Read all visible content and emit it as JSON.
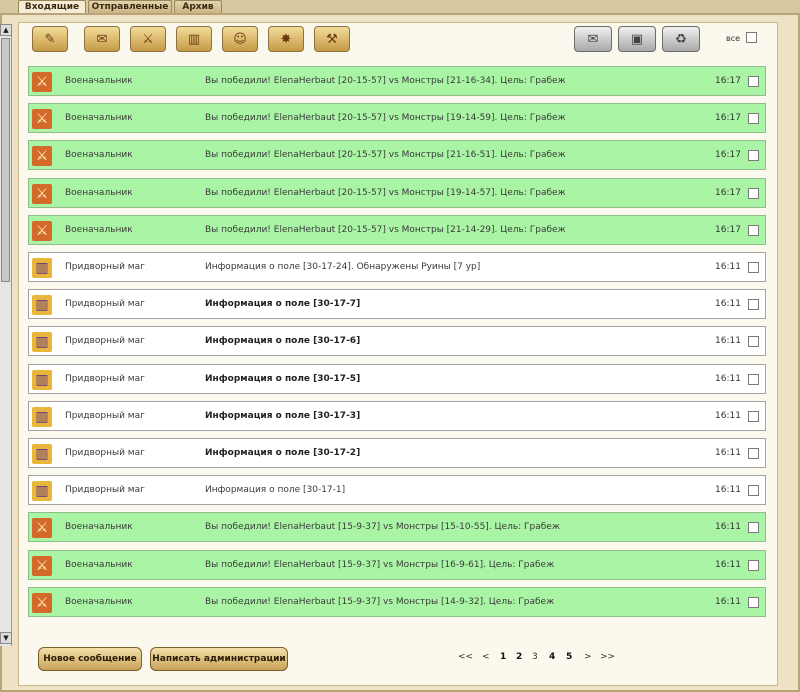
{
  "tabs": [
    "Входящие",
    "Отправленные",
    "Архив"
  ],
  "toolbar": {
    "icons": [
      "scroll-icon",
      "report-icon",
      "sword-icon",
      "book-icon",
      "people-icon",
      "explosion-icon",
      "worker-icon"
    ],
    "right_icons": [
      "envelope-icon",
      "save-icon",
      "trash-icon"
    ],
    "all_label": "все"
  },
  "messages": [
    {
      "type": "sword",
      "sender": "Военачальник",
      "subject": "Вы победили! ElenaHerbaut [20-15-57] vs Монстры [21-16-34]. Цель: Грабеж",
      "time": "16:17",
      "bold": false
    },
    {
      "type": "sword",
      "sender": "Военачальник",
      "subject": "Вы победили! ElenaHerbaut [20-15-57] vs Монстры [19-14-59]. Цель: Грабеж",
      "time": "16:17",
      "bold": false
    },
    {
      "type": "sword",
      "sender": "Военачальник",
      "subject": "Вы победили! ElenaHerbaut [20-15-57] vs Монстры [21-16-51]. Цель: Грабеж",
      "time": "16:17",
      "bold": false
    },
    {
      "type": "sword",
      "sender": "Военачальник",
      "subject": "Вы победили! ElenaHerbaut [20-15-57] vs Монстры [19-14-57]. Цель: Грабеж",
      "time": "16:17",
      "bold": false
    },
    {
      "type": "sword",
      "sender": "Военачальник",
      "subject": "Вы победили! ElenaHerbaut [20-15-57] vs Монстры [21-14-29]. Цель: Грабеж",
      "time": "16:17",
      "bold": false
    },
    {
      "type": "book",
      "sender": "Придворный маг",
      "subject": "Информация о поле [30-17-24]. Обнаружены Руины [7 ур]",
      "time": "16:11",
      "bold": false
    },
    {
      "type": "book",
      "sender": "Придворный маг",
      "subject": "Информация о поле [30-17-7]",
      "time": "16:11",
      "bold": true
    },
    {
      "type": "book",
      "sender": "Придворный маг",
      "subject": "Информация о поле [30-17-6]",
      "time": "16:11",
      "bold": true
    },
    {
      "type": "book",
      "sender": "Придворный маг",
      "subject": "Информация о поле [30-17-5]",
      "time": "16:11",
      "bold": true
    },
    {
      "type": "book",
      "sender": "Придворный маг",
      "subject": "Информация о поле [30-17-3]",
      "time": "16:11",
      "bold": true
    },
    {
      "type": "book",
      "sender": "Придворный маг",
      "subject": "Информация о поле [30-17-2]",
      "time": "16:11",
      "bold": true
    },
    {
      "type": "book",
      "sender": "Придворный маг",
      "subject": "Информация о поле [30-17-1]",
      "time": "16:11",
      "bold": false
    },
    {
      "type": "sword",
      "sender": "Военачальник",
      "subject": "Вы победили! ElenaHerbaut [15-9-37] vs Монстры [15-10-55]. Цель: Грабеж",
      "time": "16:11",
      "bold": false
    },
    {
      "type": "sword",
      "sender": "Военачальник",
      "subject": "Вы победили! ElenaHerbaut [15-9-37] vs Монстры [16-9-61]. Цель: Грабеж",
      "time": "16:11",
      "bold": false
    },
    {
      "type": "sword",
      "sender": "Военачальник",
      "subject": "Вы победили! ElenaHerbaut [15-9-37] vs Монстры [14-9-32]. Цель: Грабеж",
      "time": "16:11",
      "bold": false
    }
  ],
  "buttons": {
    "new_message": "Новое сообщение",
    "write_admin": "Написать администрации"
  },
  "pager": {
    "first": "<<",
    "prev": "<",
    "pages": [
      "1",
      "2",
      "3",
      "4",
      "5"
    ],
    "bold_pages": [
      "1",
      "2",
      "4",
      "5"
    ],
    "next": ">",
    "last": ">>"
  }
}
